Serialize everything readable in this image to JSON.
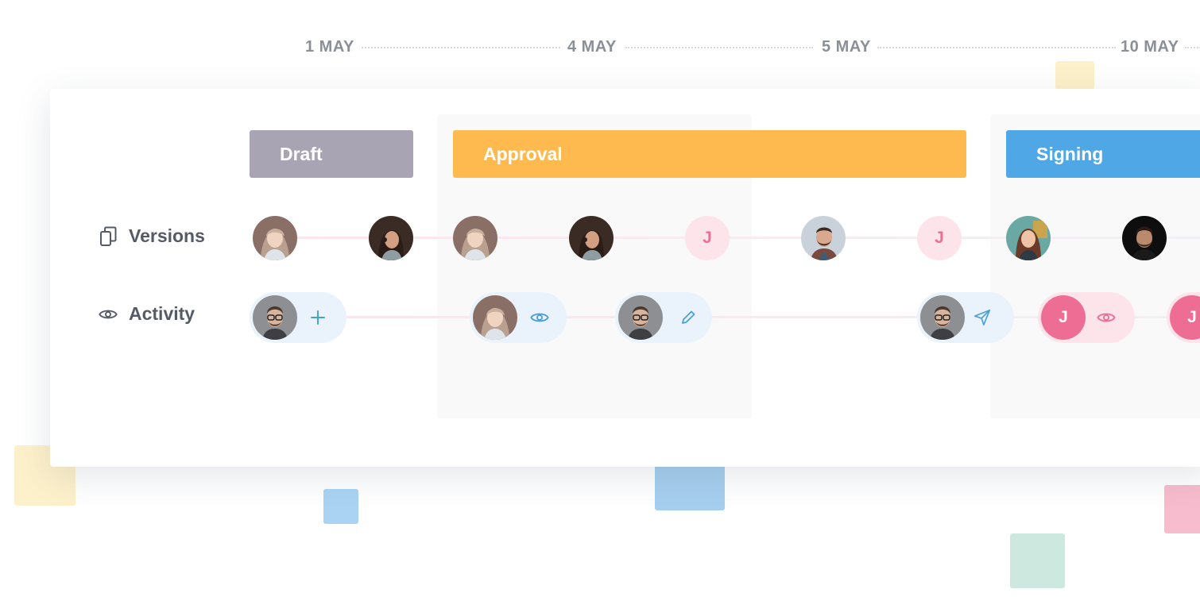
{
  "timeline": {
    "dates": [
      "1 MAY",
      "4 MAY",
      "5 MAY",
      "10 MAY"
    ]
  },
  "phases": [
    {
      "label": "Draft",
      "color": "#a8a4b3"
    },
    {
      "label": "Approval",
      "color": "#ffba4f"
    },
    {
      "label": "Signing",
      "color": "#4fa8e5"
    }
  ],
  "rows": {
    "versions": {
      "label": "Versions",
      "icon": "copy-icon"
    },
    "activity": {
      "label": "Activity",
      "icon": "eye-icon"
    }
  },
  "versions_items": [
    {
      "type": "avatar",
      "person": "woman-light-hair"
    },
    {
      "type": "avatar",
      "person": "woman-dark-hair"
    },
    {
      "type": "avatar",
      "person": "woman-light-hair"
    },
    {
      "type": "avatar",
      "person": "woman-dark-hair"
    },
    {
      "type": "initial",
      "initial": "J"
    },
    {
      "type": "avatar",
      "person": "man-beard"
    },
    {
      "type": "initial",
      "initial": "J"
    },
    {
      "type": "avatar",
      "person": "woman-red-hair"
    },
    {
      "type": "avatar",
      "person": "man-dark"
    }
  ],
  "activity_items": [
    {
      "person": "man-glasses",
      "action_icon": "plus-icon"
    },
    {
      "person": "woman-light-hair",
      "action_icon": "eye-icon"
    },
    {
      "person": "man-glasses",
      "action_icon": "pencil-icon"
    },
    {
      "person": "man-glasses",
      "action_icon": "send-icon"
    },
    {
      "initial": "J",
      "action_icon": "eye-icon"
    },
    {
      "initial": "J",
      "action_icon": ""
    }
  ],
  "colors": {
    "date_text": "#8a8f98",
    "row_text": "#555b66",
    "accent_blue": "#4a9fd8",
    "accent_pink": "#ee6d95",
    "pill_blue_bg": "#eaf3fc",
    "pill_pink_bg": "#fde3ea",
    "initial_pink_bg": "#fde3ea"
  }
}
